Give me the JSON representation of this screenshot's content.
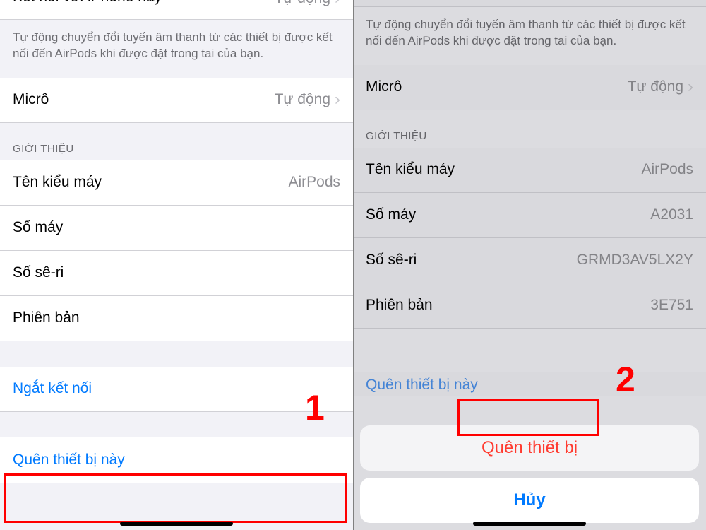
{
  "left": {
    "connect_row": {
      "label": "Kết nối với iPhone này",
      "value": "Tự động"
    },
    "footer_text": "Tự động chuyển đổi tuyến âm thanh từ các thiết bị được kết nối đến AirPods khi được đặt trong tai của bạn.",
    "micro_row": {
      "label": "Micrô",
      "value": "Tự động"
    },
    "about_header": "GIỚI THIỆU",
    "about_rows": {
      "model_name": {
        "label": "Tên kiểu máy",
        "value": "AirPods"
      },
      "model_number": {
        "label": "Số máy",
        "value": ""
      },
      "serial": {
        "label": "Số sê-ri",
        "value": ""
      },
      "version": {
        "label": "Phiên bản",
        "value": ""
      }
    },
    "disconnect": "Ngắt kết nối",
    "forget": "Quên thiết bị này",
    "annotation": "1"
  },
  "right": {
    "footer_text": "Tự động chuyển đổi tuyến âm thanh từ các thiết bị được kết nối đến AirPods khi được đặt trong tai của bạn.",
    "micro_row": {
      "label": "Micrô",
      "value": "Tự động"
    },
    "about_header": "GIỚI THIỆU",
    "about_rows": {
      "model_name": {
        "label": "Tên kiểu máy",
        "value": "AirPods"
      },
      "model_number": {
        "label": "Số máy",
        "value": "A2031"
      },
      "serial": {
        "label": "Số sê-ri",
        "value": "GRMD3AV5LX2Y"
      },
      "version": {
        "label": "Phiên bản",
        "value": "3E751"
      }
    },
    "forget_partial": "Quên thiết bị này",
    "annotation": "2",
    "sheet": {
      "forget": "Quên thiết bị",
      "cancel": "Hủy"
    }
  }
}
